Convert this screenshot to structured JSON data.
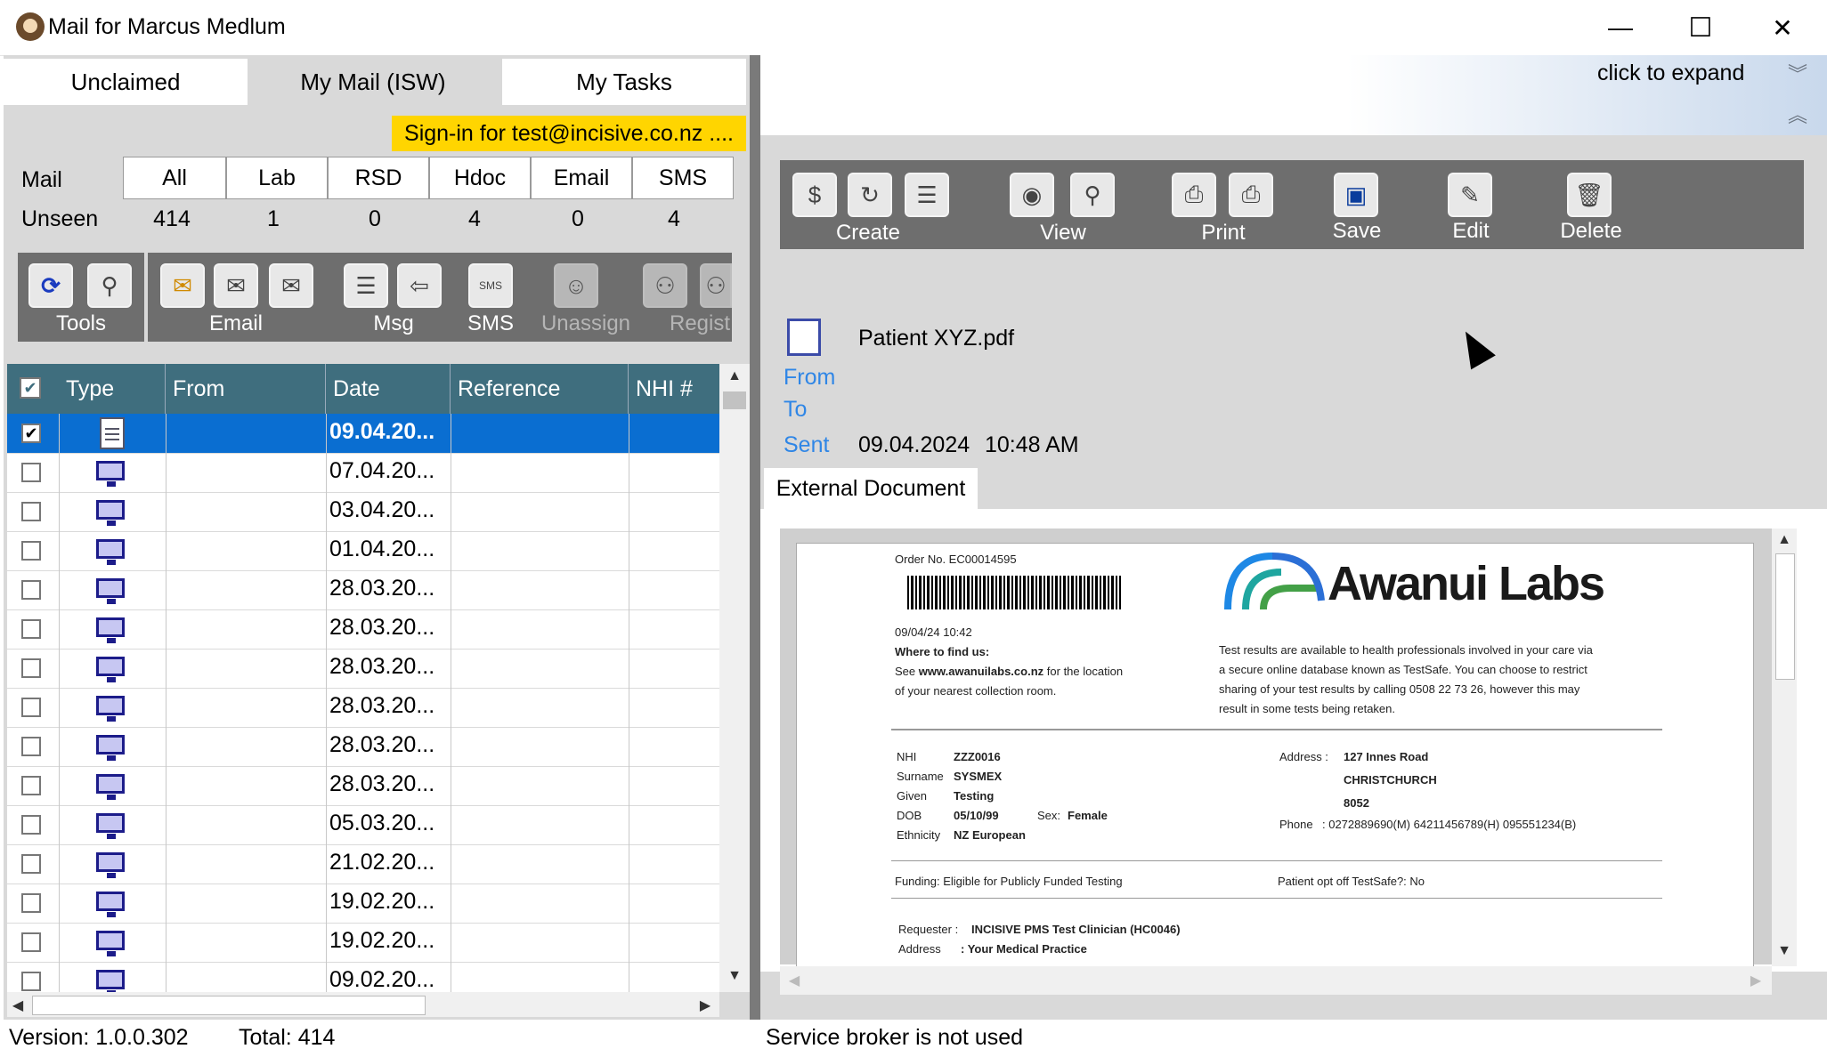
{
  "window": {
    "title": "Mail for Marcus Medlum",
    "minimize": "—",
    "maximize": "☐",
    "close": "✕"
  },
  "tabs": [
    "Unclaimed",
    "My Mail (ISW)",
    "My Tasks"
  ],
  "signin": "Sign-in for test@incisive.co.nz ....",
  "mail_filters": {
    "mail_label": "Mail",
    "unseen_label": "Unseen",
    "columns": [
      "All",
      "Lab",
      "RSD",
      "Hdoc",
      "Email",
      "SMS"
    ],
    "unseen": [
      "414",
      "1",
      "0",
      "4",
      "0",
      "4"
    ]
  },
  "left_toolbar": {
    "tools": "Tools",
    "email": "Email",
    "msg": "Msg",
    "sms": "SMS",
    "unassign": "Unassign",
    "register": "Regist"
  },
  "grid": {
    "headers": [
      "Type",
      "From",
      "Date",
      "Reference",
      "NHI #"
    ],
    "rows": [
      {
        "date": "09.04.20...",
        "selected": true,
        "type": "document"
      },
      {
        "date": "07.04.20...",
        "type": "monitor"
      },
      {
        "date": "03.04.20...",
        "type": "monitor"
      },
      {
        "date": "01.04.20...",
        "type": "monitor"
      },
      {
        "date": "28.03.20...",
        "type": "monitor"
      },
      {
        "date": "28.03.20...",
        "type": "monitor"
      },
      {
        "date": "28.03.20...",
        "type": "monitor"
      },
      {
        "date": "28.03.20...",
        "type": "monitor"
      },
      {
        "date": "28.03.20...",
        "type": "monitor"
      },
      {
        "date": "28.03.20...",
        "type": "monitor"
      },
      {
        "date": "05.03.20...",
        "type": "monitor"
      },
      {
        "date": "21.02.20...",
        "type": "monitor"
      },
      {
        "date": "19.02.20...",
        "type": "monitor"
      },
      {
        "date": "19.02.20...",
        "type": "monitor"
      },
      {
        "date": "09.02.20...",
        "type": "monitor"
      }
    ]
  },
  "status_left": {
    "version": "Version: 1.0.0.302",
    "total": "Total: 414"
  },
  "status_right": "Service broker is not used",
  "expand": "click to expand",
  "right_toolbar": {
    "create": "Create",
    "view": "View",
    "print": "Print",
    "save": "Save",
    "edit": "Edit",
    "delete": "Delete"
  },
  "message": {
    "filename": "Patient XYZ.pdf",
    "from_label": "From",
    "to_label": "To",
    "sent_label": "Sent",
    "sent_date": "09.04.2024",
    "sent_time": "10:48 AM"
  },
  "doc_tab": "External Document",
  "pdf": {
    "order_no": "Order No. EC00014595",
    "datetime": "09/04/24 10:42",
    "where_title": "Where to find us:",
    "where_line1a": "See",
    "where_site": "www.awanuilabs.co.nz",
    "where_line1b": "for the location",
    "where_line2": "of your nearest collection room.",
    "brand": "Awanui Labs",
    "notice1": "Test results are available to health professionals involved in your care via",
    "notice2": "a secure online database known as TestSafe. You can choose to restrict",
    "notice3": "sharing of your test results by calling 0508 22 73 26, however this may",
    "notice4": "result in some tests being retaken.",
    "nhi_l": "NHI",
    "nhi_v": "ZZZ0016",
    "surname_l": "Surname",
    "surname_v": "SYSMEX",
    "given_l": "Given",
    "given_v": "Testing",
    "dob_l": "DOB",
    "dob_v": "05/10/99",
    "sex_l": "Sex:",
    "sex_v": "Female",
    "eth_l": "Ethnicity",
    "eth_v": "NZ European",
    "addr_l": "Address :",
    "addr_v1": "127 Innes Road",
    "addr_v2": "CHRISTCHURCH",
    "addr_v3": "8052",
    "phone_l": "Phone",
    "phone_v": ": 0272889690(M) 64211456789(H) 095551234(B)",
    "funding": "Funding: Eligible for Publicly Funded Testing",
    "optoff": "Patient opt off TestSafe?: No",
    "req_l": "Requester :",
    "req_v": "INCISIVE PMS Test Clinician (HC0046)",
    "raddr_l": "Address",
    "raddr_v": ": Your Medical Practice"
  },
  "colors": {
    "grid_header": "#3f6e7e",
    "selection": "#0a6ed1",
    "signin_bg": "#ffd500",
    "meta_label": "#2f86e6"
  }
}
